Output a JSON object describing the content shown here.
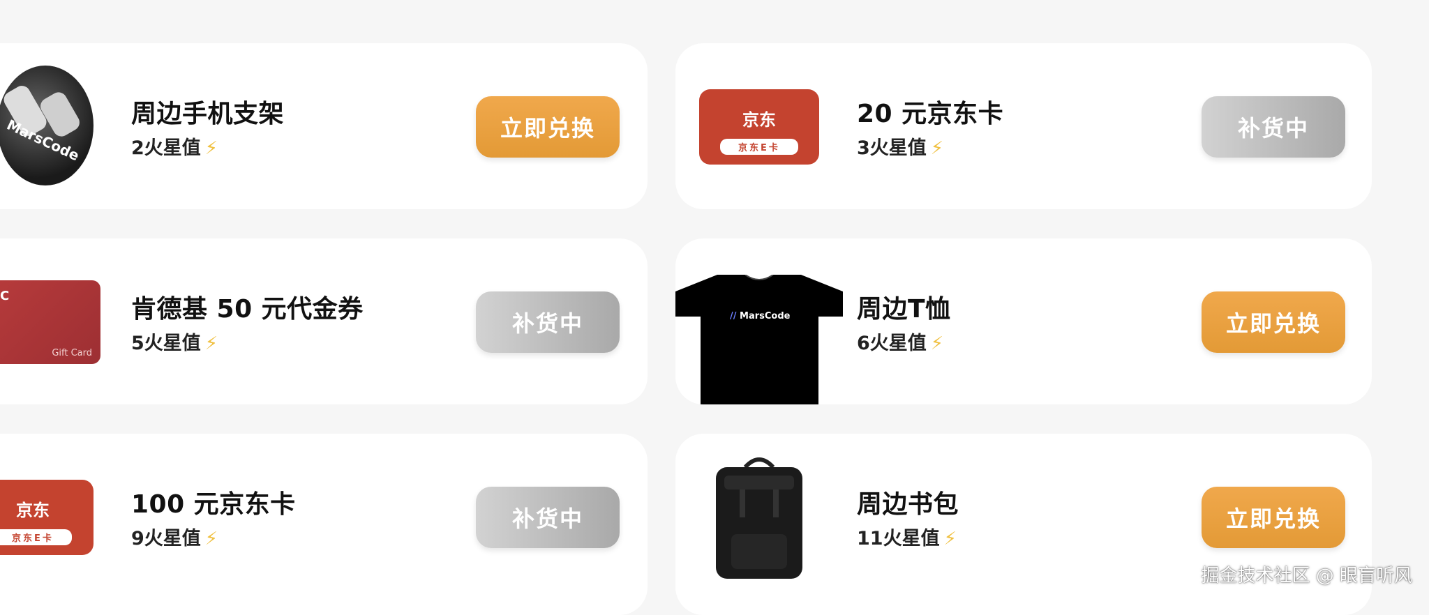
{
  "products": [
    {
      "title": "周边手机支架",
      "price": "2火星值",
      "button": "立即兑换",
      "status": "available",
      "image": "marscode-phone-stand"
    },
    {
      "title": "20 元京东卡",
      "price": "3火星值",
      "button": "补货中",
      "status": "restocking",
      "image": "jd-card"
    },
    {
      "title": "肯德基 50 元代金券",
      "price": "5火星值",
      "button": "补货中",
      "status": "restocking",
      "image": "kfc-gift-card"
    },
    {
      "title": "周边T恤",
      "price": "6火星值",
      "button": "立即兑换",
      "status": "available",
      "image": "marscode-tshirt"
    },
    {
      "title": "100 元京东卡",
      "price": "9火星值",
      "button": "补货中",
      "status": "restocking",
      "image": "jd-card"
    },
    {
      "title": "周边书包",
      "price": "11火星值",
      "button": "立即兑换",
      "status": "available",
      "image": "backpack"
    }
  ],
  "images": {
    "phone_stand_text": "MarsCode",
    "jd_logo": "京东",
    "jd_pill": "京东E卡",
    "kfc_text": "Gift Card",
    "tshirt_logo": "MarsCode"
  },
  "icons": {
    "price": "lightning-icon",
    "bolt_char": "⚡"
  },
  "colors": {
    "button_available": "#e9a13f",
    "button_restocking": "#b8b8b8",
    "page_bg": "#f6f6f6",
    "card_bg": "#ffffff"
  },
  "watermark": "掘金技术社区 @ 眼盲听风"
}
